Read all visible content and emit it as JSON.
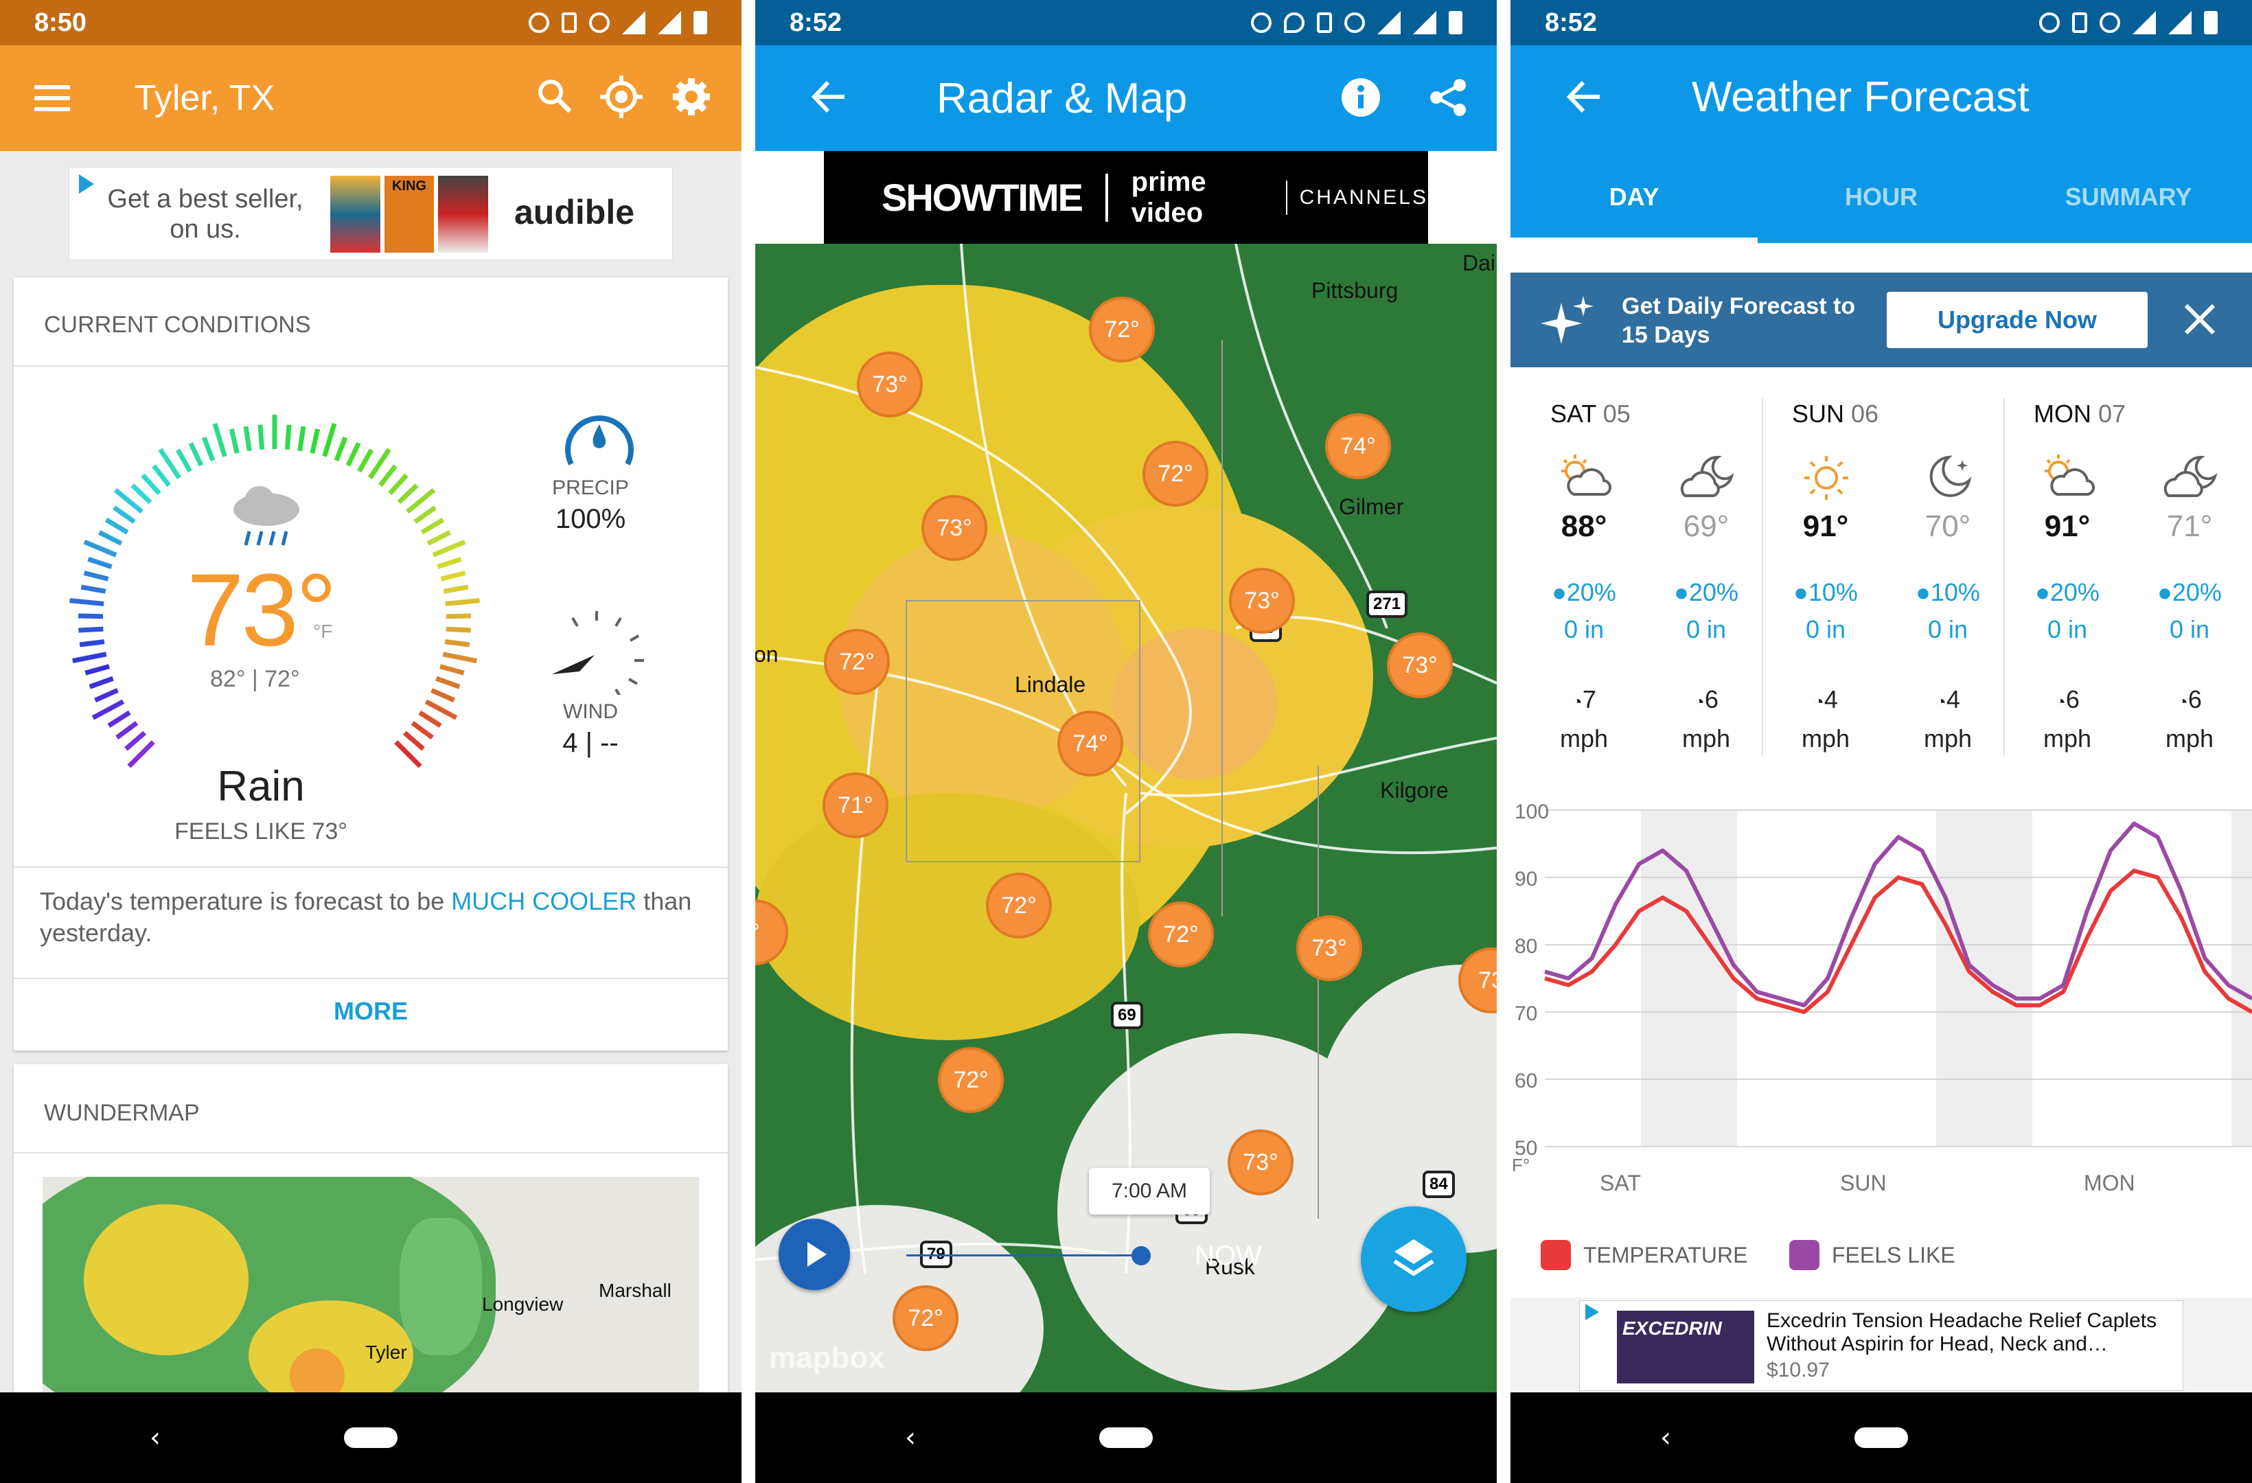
{
  "panel1": {
    "status_time": "8:50",
    "app_title": "Tyler, TX",
    "ad": {
      "text": "Get a best seller, on us.",
      "brand": "audible",
      "book_label": "KING"
    },
    "current_conditions": {
      "header": "CURRENT CONDITIONS",
      "temperature": "73°",
      "unit": "°F",
      "hi_lo": "82° | 72°",
      "condition": "Rain",
      "feels_like": "FEELS LIKE 73°",
      "precip_label": "PRECIP",
      "precip_value": "100%",
      "wind_label": "WIND",
      "wind_value": "4 | --",
      "forecast_text_1": "Today's temperature is forecast to be",
      "forecast_highlight": "MUCH COOLER",
      "forecast_text_2": "than yesterday.",
      "more_label": "MORE"
    },
    "wundermap": {
      "header": "WUNDERMAP",
      "cities": [
        "Longview",
        "Marshall",
        "Tyler"
      ]
    }
  },
  "panel2": {
    "status_time": "8:52",
    "app_title": "Radar & Map",
    "ad": {
      "brand1": "SHOWTIME",
      "brand2": "prime video",
      "brand3": "CHANNELS"
    },
    "cities": [
      "Pittsburg",
      "Gilmer",
      "Lindale",
      "Kilgore",
      "Rusk",
      "Dai",
      "on"
    ],
    "temp_pins": [
      "73°",
      "72°",
      "72°",
      "73°",
      "74°",
      "72°",
      "73°",
      "74°",
      "71°",
      "72°",
      "72°",
      "73°",
      "72°",
      "73°",
      "72°",
      "73°",
      "73",
      "°"
    ],
    "highways": [
      "80",
      "271",
      "69",
      "84",
      "79",
      "69"
    ],
    "time_label": "7:00 AM",
    "now_label": "NOW",
    "watermark": "mapbox"
  },
  "panel3": {
    "status_time": "8:52",
    "app_title": "Weather Forecast",
    "tabs": [
      "DAY",
      "HOUR",
      "SUMMARY"
    ],
    "promo": {
      "line1": "Get Daily Forecast to",
      "line2": "15 Days",
      "button": "Upgrade Now"
    },
    "days": [
      {
        "name": "SAT",
        "num": "05",
        "day": {
          "temp": "88°",
          "precip": "20%",
          "amount": "0 in",
          "wind": "7",
          "wind_unit": "mph",
          "icon": "partly-cloudy-day-icon"
        },
        "night": {
          "temp": "69°",
          "precip": "20%",
          "amount": "0 in",
          "wind": "6",
          "wind_unit": "mph",
          "icon": "partly-cloudy-night-icon"
        }
      },
      {
        "name": "SUN",
        "num": "06",
        "day": {
          "temp": "91°",
          "precip": "10%",
          "amount": "0 in",
          "wind": "4",
          "wind_unit": "mph",
          "icon": "sunny-icon"
        },
        "night": {
          "temp": "70°",
          "precip": "10%",
          "amount": "0 in",
          "wind": "4",
          "wind_unit": "mph",
          "icon": "clear-night-icon"
        }
      },
      {
        "name": "MON",
        "num": "07",
        "day": {
          "temp": "91°",
          "precip": "20%",
          "amount": "0 in",
          "wind": "6",
          "wind_unit": "mph",
          "icon": "partly-cloudy-day-icon"
        },
        "night": {
          "temp": "71°",
          "precip": "20%",
          "amount": "0 in",
          "wind": "6",
          "wind_unit": "mph",
          "icon": "partly-cloudy-night-icon"
        }
      }
    ],
    "chart_data": {
      "type": "line",
      "y_ticks": [
        "100",
        "90",
        "80",
        "70",
        "60",
        "50"
      ],
      "y_unit": "F°",
      "ylim": [
        50,
        100
      ],
      "x_labels": [
        "SAT",
        "SUN",
        "MON"
      ],
      "series": [
        {
          "name": "TEMPERATURE",
          "color": "#e83a3a",
          "values": [
            75,
            74,
            76,
            80,
            85,
            87,
            85,
            80,
            75,
            72,
            71,
            70,
            73,
            80,
            87,
            90,
            89,
            83,
            76,
            73,
            71,
            71,
            73,
            81,
            88,
            91,
            90,
            84,
            76,
            72,
            70
          ]
        },
        {
          "name": "FEELS LIKE",
          "color": "#9a4aa5",
          "values": [
            76,
            75,
            78,
            86,
            92,
            94,
            91,
            84,
            77,
            73,
            72,
            71,
            75,
            84,
            92,
            96,
            94,
            87,
            77,
            74,
            72,
            72,
            74,
            85,
            94,
            98,
            96,
            88,
            78,
            74,
            72
          ]
        }
      ]
    },
    "legend": [
      "TEMPERATURE",
      "FEELS LIKE"
    ],
    "ad": {
      "brand": "EXCEDRIN",
      "title": "Excedrin Tension Headache Relief Caplets",
      "subtitle": "Without Aspirin for Head, Neck and…",
      "price": "$10.97"
    }
  }
}
